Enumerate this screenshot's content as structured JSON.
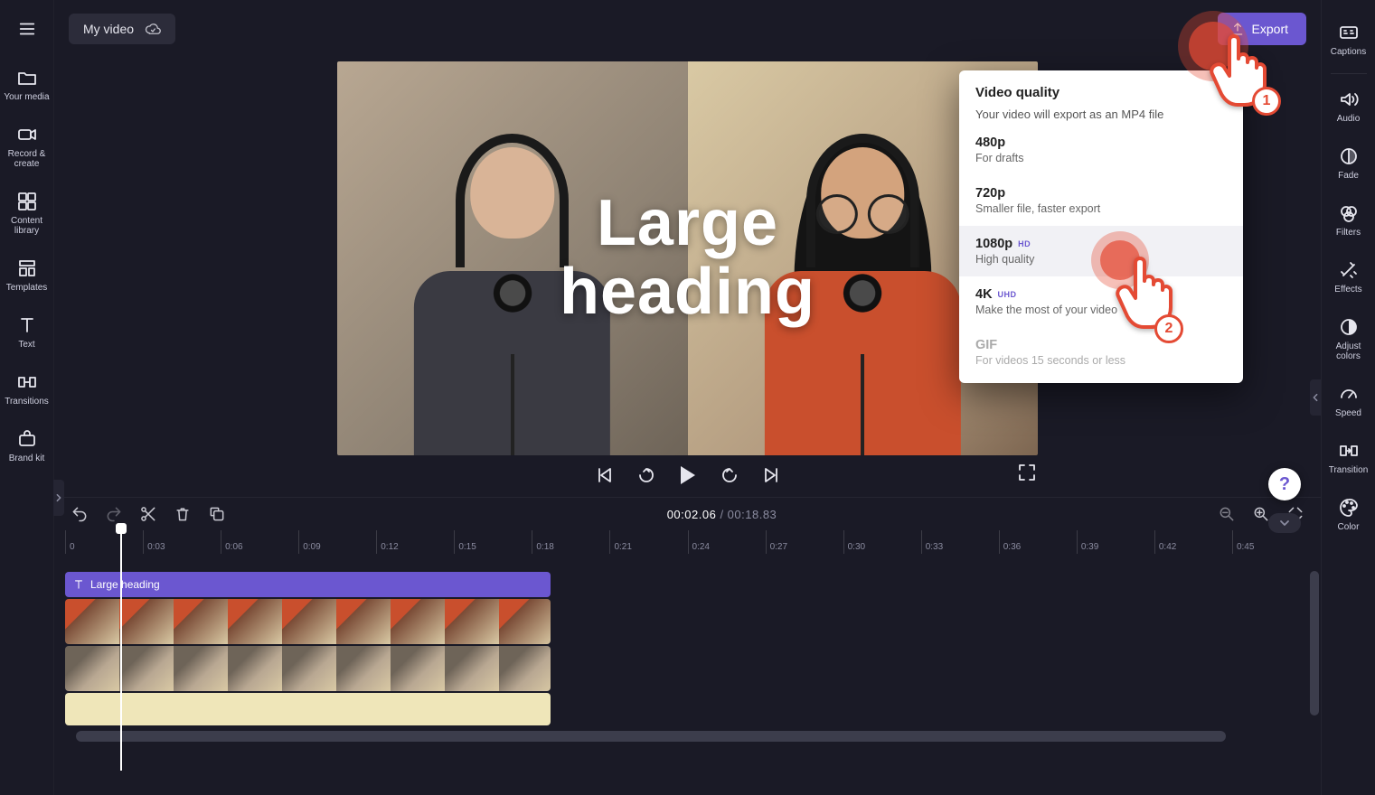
{
  "header": {
    "project_title": "My video",
    "export_label": "Export"
  },
  "leftSidebar": {
    "items": [
      {
        "label": "Your media"
      },
      {
        "label": "Record & create"
      },
      {
        "label": "Content library"
      },
      {
        "label": "Templates"
      },
      {
        "label": "Text"
      },
      {
        "label": "Transitions"
      },
      {
        "label": "Brand kit"
      }
    ]
  },
  "rightSidebar": {
    "items": [
      {
        "label": "Captions"
      },
      {
        "label": "Audio"
      },
      {
        "label": "Fade"
      },
      {
        "label": "Filters"
      },
      {
        "label": "Effects"
      },
      {
        "label": "Adjust colors"
      },
      {
        "label": "Speed"
      },
      {
        "label": "Transition"
      },
      {
        "label": "Color"
      }
    ]
  },
  "preview": {
    "overlay_text": "Large\nheading"
  },
  "exportDropdown": {
    "title": "Video quality",
    "subtitle": "Your video will export as an MP4 file",
    "options": [
      {
        "title": "480p",
        "desc": "For drafts",
        "badge": ""
      },
      {
        "title": "720p",
        "desc": "Smaller file, faster export",
        "badge": ""
      },
      {
        "title": "1080p",
        "desc": "High quality",
        "badge": "HD"
      },
      {
        "title": "4K",
        "desc": "Make the most of your video",
        "badge": "UHD"
      },
      {
        "title": "GIF",
        "desc": "For videos 15 seconds or less",
        "badge": ""
      }
    ]
  },
  "annotations": {
    "step1": "1",
    "step2": "2"
  },
  "timeline": {
    "current": "00:02.06",
    "total": "00:18.83",
    "ruler": [
      "0",
      "0:03",
      "0:06",
      "0:09",
      "0:12",
      "0:15",
      "0:18",
      "0:21",
      "0:24",
      "0:27",
      "0:30",
      "0:33",
      "0:36",
      "0:39",
      "0:42",
      "0:45"
    ],
    "text_clip_label": "Large heading"
  },
  "help": {
    "label": "?"
  }
}
